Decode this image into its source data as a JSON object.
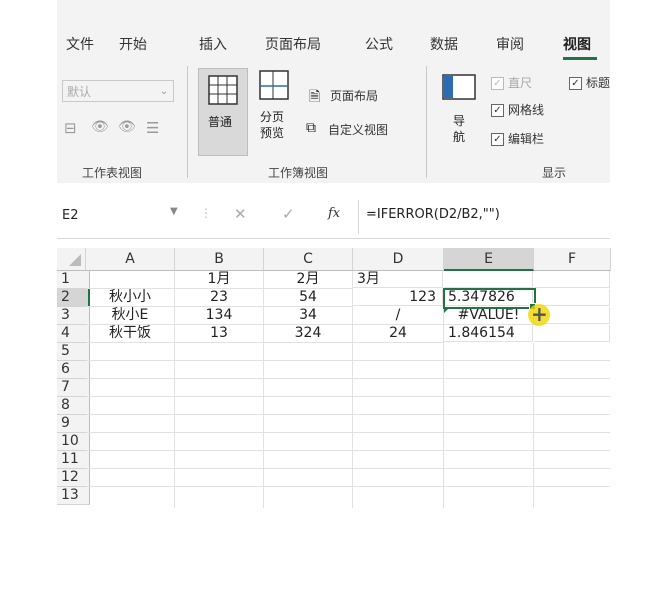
{
  "tabs": [
    "文件",
    "开始",
    "插入",
    "页面布局",
    "公式",
    "数据",
    "审阅",
    "视图"
  ],
  "ribbon": {
    "default_dropdown": "默认",
    "normal_label": "普通",
    "page_break_label": "分页\n预览",
    "page_break_line1": "分页",
    "page_break_line2": "预览",
    "page_layout_label": "页面布局",
    "custom_view_label": "自定义视图",
    "nav_line1": "导",
    "nav_line2": "航",
    "ruler_label": "直尺",
    "gridlines_label": "网格线",
    "formula_bar_label": "编辑栏",
    "headings_label": "标题",
    "group_sheet_view": "工作表视图",
    "group_workbook_view": "工作簿视图",
    "group_show": "显示"
  },
  "formula_bar": {
    "name_box": "E2",
    "cancel_symbol": "✕",
    "enter_symbol": "✓",
    "fx_symbol": "fx",
    "formula": "=IFERROR(D2/B2,\"\")"
  },
  "grid": {
    "columns": [
      "A",
      "B",
      "C",
      "D",
      "E",
      "F"
    ],
    "row_numbers": [
      "1",
      "2",
      "3",
      "4",
      "5",
      "6",
      "7",
      "8",
      "9",
      "10",
      "11",
      "12",
      "13"
    ],
    "rows": [
      [
        "",
        "1月",
        "2月",
        "3月",
        "",
        ""
      ],
      [
        "秋小小",
        "23",
        "54",
        "123",
        "5.347826",
        ""
      ],
      [
        "秋小E",
        "134",
        "34",
        "/",
        "#VALUE!",
        ""
      ],
      [
        "秋干饭",
        "13",
        "324",
        "24",
        "1.846154",
        ""
      ]
    ],
    "active_cell": "E2"
  },
  "colors": {
    "accent": "#217346",
    "cursor": "#f2d600",
    "ribbon_bg": "#f3f3f3"
  }
}
